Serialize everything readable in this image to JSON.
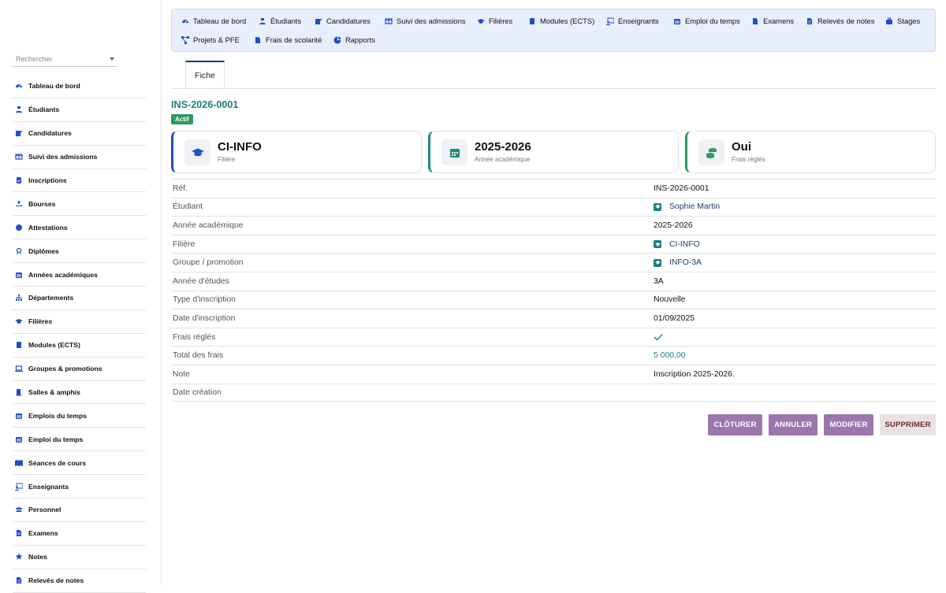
{
  "search": {
    "placeholder": "Rechercher"
  },
  "sidebar": {
    "items": [
      {
        "label": "Tableau de bord",
        "icon": "gauge-icon"
      },
      {
        "label": "Étudiants",
        "icon": "student-icon"
      },
      {
        "label": "Candidatures",
        "icon": "edit-icon"
      },
      {
        "label": "Suivi des admissions",
        "icon": "columns-icon"
      },
      {
        "label": "Inscriptions",
        "icon": "clipboard-check-icon"
      },
      {
        "label": "Bourses",
        "icon": "hand-coin-icon"
      },
      {
        "label": "Attestations",
        "icon": "certificate-icon"
      },
      {
        "label": "Diplômes",
        "icon": "award-icon"
      },
      {
        "label": "Années académiques",
        "icon": "calendar-icon"
      },
      {
        "label": "Départements",
        "icon": "sitemap-icon"
      },
      {
        "label": "Filières",
        "icon": "graduation-cap-icon"
      },
      {
        "label": "Modules (ECTS)",
        "icon": "book-icon"
      },
      {
        "label": "Groupes & promotions",
        "icon": "laptop-icon"
      },
      {
        "label": "Salles & amphis",
        "icon": "door-icon"
      },
      {
        "label": "Emplois du temps",
        "icon": "calendar-icon"
      },
      {
        "label": "Emploi du temps",
        "icon": "calendar-icon"
      },
      {
        "label": "Séances de cours",
        "icon": "open-book-icon"
      },
      {
        "label": "Enseignants",
        "icon": "teacher-icon"
      },
      {
        "label": "Personnel",
        "icon": "users-icon"
      },
      {
        "label": "Examens",
        "icon": "file-icon"
      },
      {
        "label": "Notes",
        "icon": "star-icon"
      },
      {
        "label": "Relevés de notes",
        "icon": "file-lines-icon"
      }
    ]
  },
  "topnav": {
    "items": [
      {
        "label": "Tableau de bord",
        "icon": "gauge-icon"
      },
      {
        "label": "Étudiants",
        "icon": "student-icon"
      },
      {
        "label": "Candidatures",
        "icon": "edit-icon"
      },
      {
        "label": "Suivi des admissions",
        "icon": "columns-icon"
      },
      {
        "label": "Filières",
        "icon": "graduation-cap-icon"
      },
      {
        "label": "Modules (ECTS)",
        "icon": "book-icon"
      },
      {
        "label": "Enseignants",
        "icon": "teacher-icon"
      },
      {
        "label": "Emploi du temps",
        "icon": "calendar-icon"
      },
      {
        "label": "Examens",
        "icon": "file-icon"
      },
      {
        "label": "Relevés de notes",
        "icon": "file-lines-icon"
      },
      {
        "label": "Stages",
        "icon": "briefcase-icon"
      },
      {
        "label": "Projets & PFE",
        "icon": "diagram-icon"
      },
      {
        "label": "Frais de scolarité",
        "icon": "file-invoice-icon"
      },
      {
        "label": "Rapports",
        "icon": "pie-chart-icon"
      }
    ]
  },
  "tabs": {
    "fiche": "Fiche"
  },
  "record": {
    "id": "INS-2026-0001",
    "status": "Actif",
    "status_color": "#2c9a5e"
  },
  "cards": [
    {
      "value": "CI-INFO",
      "label": "Filière",
      "icon": "graduation-cap-icon",
      "accent": "#1f4fc8"
    },
    {
      "value": "2025-2026",
      "label": "Année académique",
      "icon": "calendar-icon",
      "accent": "#1d8a82"
    },
    {
      "value": "Oui",
      "label": "Frais réglés",
      "icon": "coins-icon",
      "accent": "#2c9a5e"
    }
  ],
  "details": [
    {
      "key": "Réf.",
      "value": "INS-2026-0001"
    },
    {
      "key": "Étudiant",
      "value": "Sophie Martin"
    },
    {
      "key": "Année académique",
      "value": "2025-2026"
    },
    {
      "key": "Filière",
      "value": "CI-INFO"
    },
    {
      "key": "Groupe / promotion",
      "value": "INFO-3A"
    },
    {
      "key": "Année d'études",
      "value": "3A"
    },
    {
      "key": "Type d'inscription",
      "value": "Nouvelle"
    },
    {
      "key": "Date d'inscription",
      "value": "01/09/2025"
    },
    {
      "key": "Frais réglés",
      "value": ""
    },
    {
      "key": "Total des frais",
      "value": "5 000,00"
    },
    {
      "key": "Note",
      "value": "Inscription 2025-2026."
    },
    {
      "key": "Date création",
      "value": ""
    }
  ],
  "actions": {
    "close": "CLÔTURER",
    "cancel": "ANNULER",
    "edit": "MODIFIER",
    "delete": "SUPPRIMER"
  },
  "colors": {
    "accent_teal": "#1d7d80",
    "nav_bg": "#e9eefc",
    "nav_icon": "#1f4fc8",
    "button_purple": "#9c77ad",
    "check_green": "#2c9a5e"
  }
}
